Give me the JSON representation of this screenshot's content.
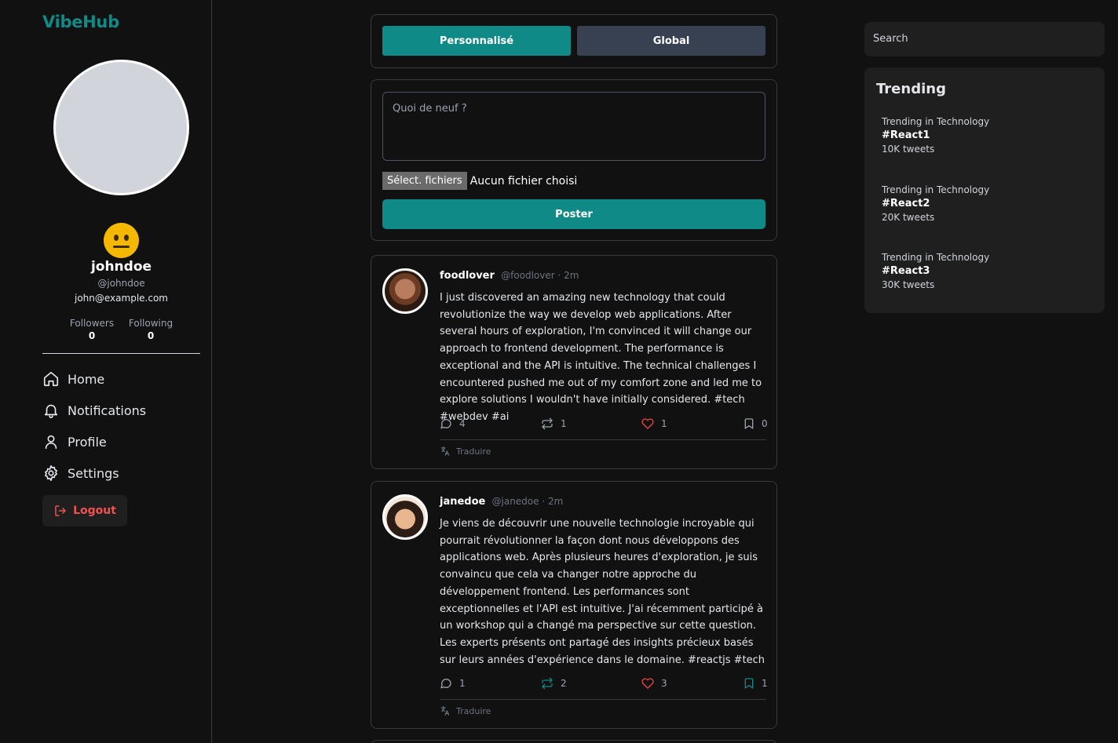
{
  "app": {
    "brand": "VibeHub"
  },
  "profile": {
    "username": "johndoe",
    "handle": "@johndoe",
    "email": "john@example.com",
    "followers_label": "Followers",
    "followers": "0",
    "following_label": "Following",
    "following": "0"
  },
  "nav": {
    "items": [
      {
        "label": "Home",
        "icon": "home-icon"
      },
      {
        "label": "Notifications",
        "icon": "bell-icon"
      },
      {
        "label": "Profile",
        "icon": "user-icon"
      },
      {
        "label": "Settings",
        "icon": "gear-icon"
      }
    ],
    "logout": "Logout"
  },
  "feed_tabs": {
    "personalized": "Personnalisé",
    "global": "Global",
    "active": "personalized"
  },
  "composer": {
    "placeholder": "Quoi de neuf ?",
    "file_button": "Sélect. fichiers",
    "file_status": "Aucun fichier choisi",
    "post_button": "Poster"
  },
  "posts": [
    {
      "author": "foodlover",
      "meta": "@foodlover · 2m",
      "text": "I just discovered an amazing new technology that could revolutionize the way we develop web applications. After several hours of exploration, I'm convinced it will change our approach to frontend development. The performance is exceptional and the API is intuitive. The technical challenges I encountered pushed me out of my comfort zone and led me to explore solutions I wouldn't have initially considered. #tech #webdev #ai",
      "comments": "4",
      "retweets": "1",
      "likes": "1",
      "bookmarks": "0",
      "translate": "Traduire"
    },
    {
      "author": "janedoe",
      "meta": "@janedoe · 2m",
      "text": "Je viens de découvrir une nouvelle technologie incroyable qui pourrait révolutionner la façon dont nous développons des applications web. Après plusieurs heures d'exploration, je suis convaincu que cela va changer notre approche du développement frontend. Les performances sont exceptionnelles et l'API est intuitive. J'ai récemment participé à un workshop qui a changé ma perspective sur cette question. Les experts présents ont partagé des insights précieux basés sur leurs années d'expérience dans le domaine. #reactjs #tech",
      "comments": "1",
      "retweets": "2",
      "likes": "3",
      "bookmarks": "1",
      "translate": "Traduire"
    }
  ],
  "search": {
    "placeholder": "Search"
  },
  "trending": {
    "title": "Trending",
    "items": [
      {
        "category": "Trending in Technology",
        "tag": "#React1",
        "count": "10K tweets"
      },
      {
        "category": "Trending in Technology",
        "tag": "#React2",
        "count": "20K tweets"
      },
      {
        "category": "Trending in Technology",
        "tag": "#React3",
        "count": "30K tweets"
      }
    ]
  },
  "colors": {
    "accent": "#0f8a86",
    "danger": "#ef5350",
    "background": "#111111",
    "panel": "#1f1f1f"
  }
}
